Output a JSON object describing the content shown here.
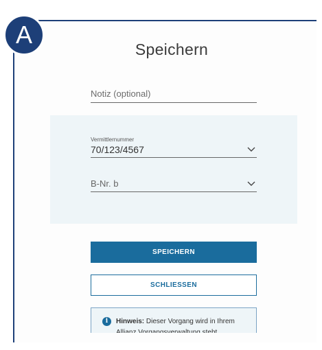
{
  "annotation": {
    "badge_letter": "A"
  },
  "dialog": {
    "title": "Speichern",
    "note_field": {
      "placeholder": "Notiz (optional)"
    },
    "broker_select": {
      "label": "Vermittlernummer",
      "value": "70/123/4567"
    },
    "bnr_select": {
      "value": "B-Nr. b"
    },
    "save_label": "SPEICHERN",
    "close_label": "SCHLIESSEN",
    "hint": {
      "icon": "info-icon",
      "prefix": "Hinweis:",
      "text": "Dieser Vorgang wird in Ihrem Allianz Vorgangsverwaltung steht"
    }
  },
  "colors": {
    "frame": "#1d3f78",
    "primary": "#1a6c9d",
    "panel_bg": "#eef5f8"
  }
}
